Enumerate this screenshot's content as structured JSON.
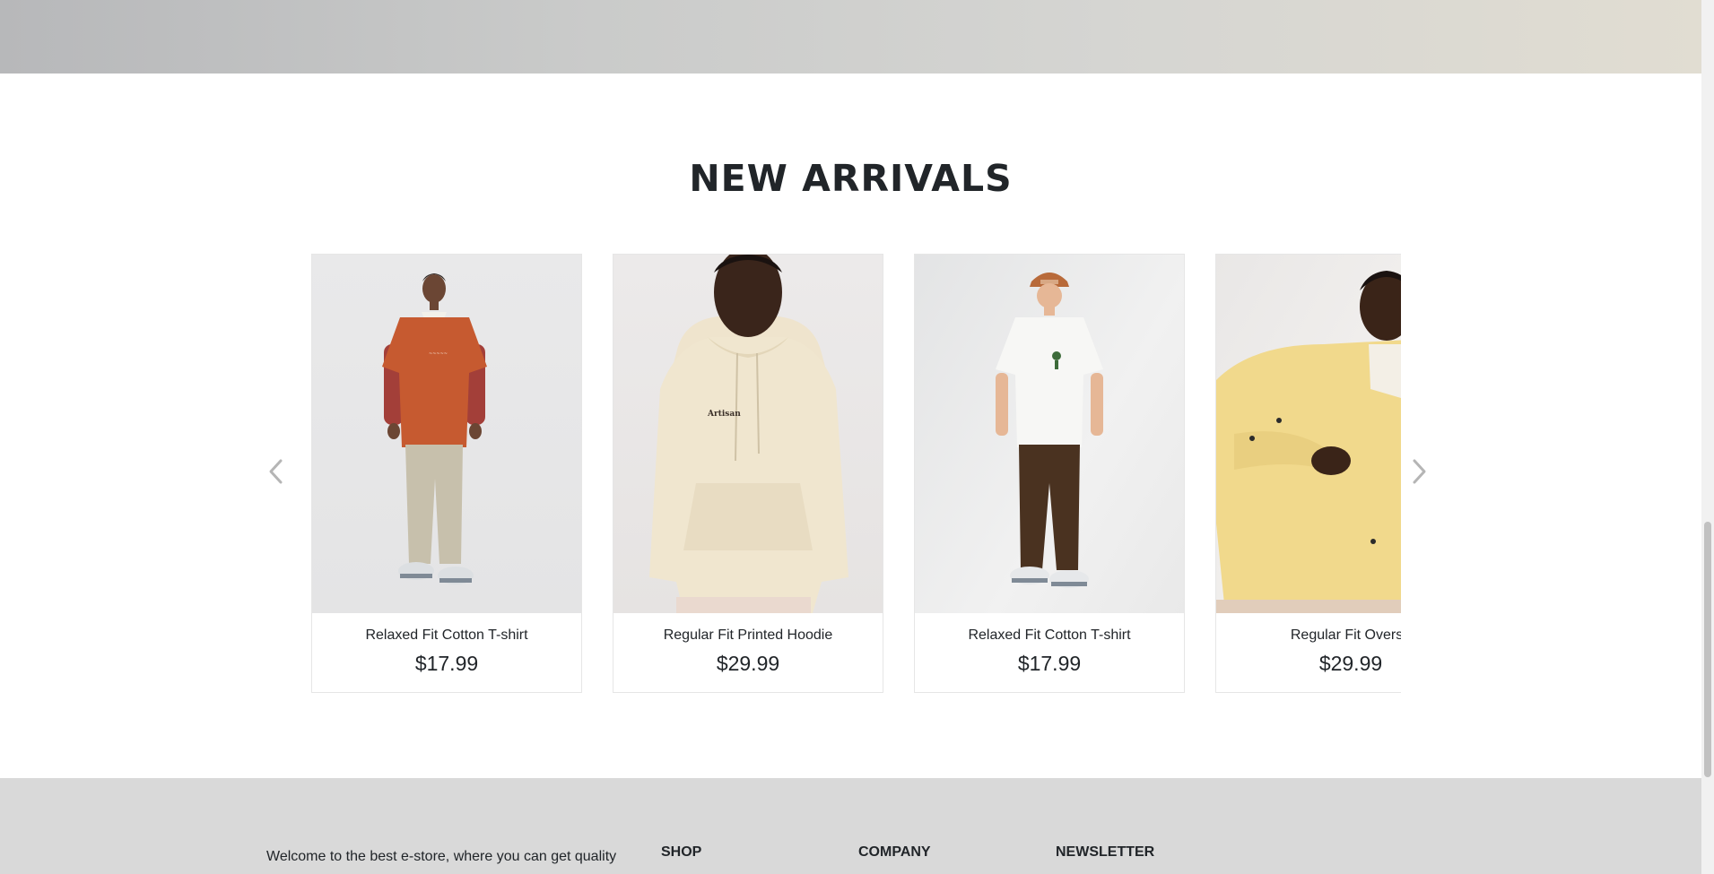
{
  "section": {
    "title": "NEW ARRIVALS"
  },
  "carousel": {
    "prev_icon": "chevron-left-icon",
    "next_icon": "chevron-right-icon",
    "products": [
      {
        "name": "Relaxed Fit Cotton T-shirt",
        "price": "$17.99",
        "image": "man in orange t-shirt and beige pants"
      },
      {
        "name": "Regular Fit Printed Hoodie",
        "price": "$29.99",
        "image": "man in cream hoodie"
      },
      {
        "name": "Relaxed Fit Cotton T-shirt",
        "price": "$17.99",
        "image": "man in white t-shirt and brown pants with cap"
      },
      {
        "name": "Regular Fit Oversh",
        "price": "$29.99",
        "image": "man in yellow overshirt on chair"
      }
    ]
  },
  "footer": {
    "about": "Welcome to the best e-store, where you can get quality",
    "headings": {
      "shop": "SHOP",
      "company": "COMPANY",
      "newsletter": "NEWSLETTER"
    }
  },
  "colors": {
    "text": "#212529",
    "footer_bg": "#d9d9d9",
    "card_border": "#e6e6e6"
  }
}
